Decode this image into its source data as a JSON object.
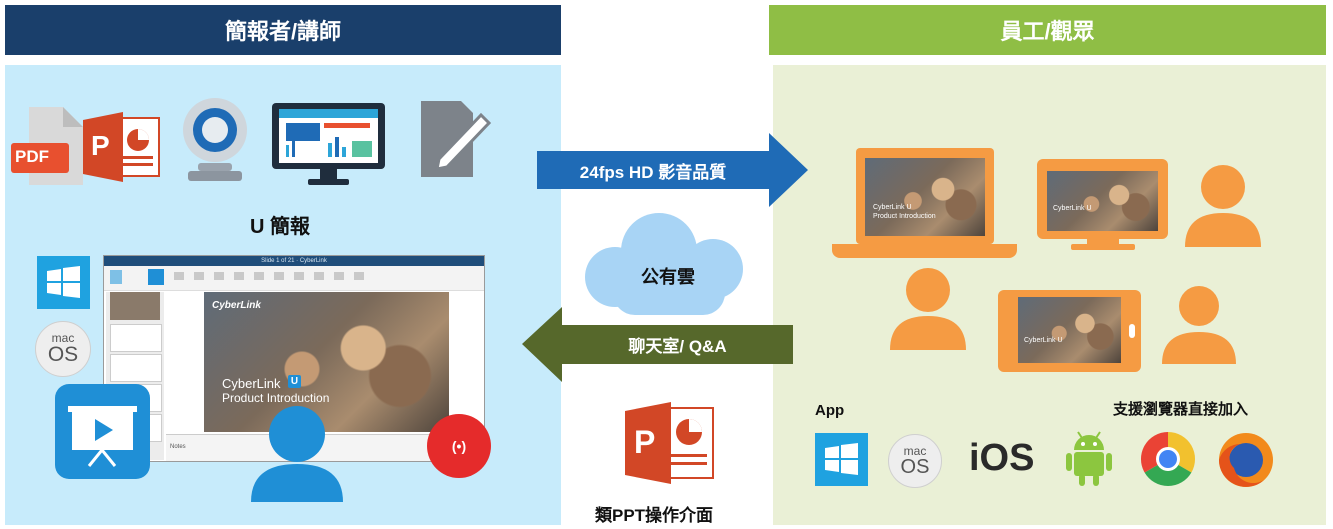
{
  "left_header": {
    "title": "簡報者/講師"
  },
  "right_header": {
    "title": "員工/觀眾"
  },
  "left_panel": {
    "u_label": "U 簡報",
    "pdf_label": "PDF",
    "ppt_letter": "P",
    "mac_line1": "mac",
    "mac_line2": "OS",
    "presentation": {
      "title_bar": "Slide 1 of 21 · CyberLink",
      "brand": "CyberLink",
      "slide_line1": "CyberLink",
      "slide_badge": "U",
      "slide_line2": "Product Introduction",
      "notes_label": "Notes"
    },
    "live_icon": "(•)"
  },
  "middle": {
    "top_arrow": "24fps HD 影音品質",
    "cloud": "公有雲",
    "bottom_arrow": "聊天室/ Q&A",
    "ppt_letter": "P",
    "ppt_label": "類PPT操作介面"
  },
  "right_panel": {
    "app_label": "App",
    "browser_label": "支援瀏覽器直接加入",
    "mac_line1": "mac",
    "mac_line2": "OS",
    "ios_label": "iOS",
    "screen_text_1": "CyberLink U",
    "screen_text_2": "Product Introduction"
  },
  "colors": {
    "left_header": "#1a3f6b",
    "right_header": "#8fbe45",
    "left_panel_bg": "#c7ebfb",
    "right_panel_bg": "#eaf0d6",
    "arrow_blue": "#1f6bb6",
    "arrow_green": "#56682b",
    "orange": "#f59b43",
    "user_blue": "#1f8fd6"
  }
}
